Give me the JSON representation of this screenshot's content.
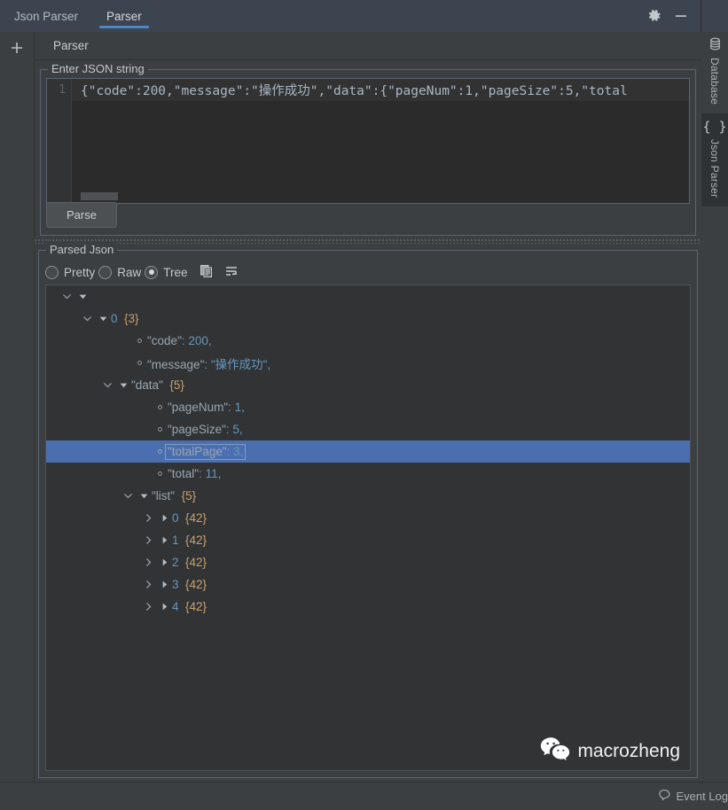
{
  "window": {
    "title": "Json Parser",
    "tabs": [
      {
        "label": "Json Parser",
        "active": false
      },
      {
        "label": "Parser",
        "active": true
      }
    ],
    "accent_color": "#4a88c7",
    "icons": {
      "settings": "gear-icon",
      "minimize": "minimize-icon"
    }
  },
  "left_toolbar": {
    "add_label": "+"
  },
  "right_stripe": {
    "buttons": [
      {
        "label": "Database",
        "icon": "database-icon",
        "selected": false
      },
      {
        "label": "Json Parser",
        "icon": "braces-icon",
        "selected": true
      }
    ]
  },
  "panel": {
    "title": "Parser"
  },
  "input_group": {
    "title": "Enter JSON string",
    "line_number": "1",
    "value": "{\"code\":200,\"message\":\"操作成功\",\"data\":{\"pageNum\":1,\"pageSize\":5,\"total",
    "parse_button": "Parse"
  },
  "output_group": {
    "title": "Parsed Json",
    "view_modes": [
      {
        "label": "Pretty",
        "selected": false
      },
      {
        "label": "Raw",
        "selected": false
      },
      {
        "label": "Tree",
        "selected": true
      }
    ],
    "tools": [
      {
        "name": "copy-icon",
        "label": "Copy"
      },
      {
        "name": "wrap-text-icon",
        "label": "Soft Wrap"
      }
    ],
    "tree": [
      {
        "indent": 0,
        "chevron": "down",
        "triangle": "down",
        "bullet": false,
        "key": "",
        "value": "",
        "count": "",
        "selected": false
      },
      {
        "indent": 1,
        "chevron": "down",
        "triangle": "down",
        "bullet": false,
        "key": "0",
        "value": "",
        "count": "{3}",
        "selected": false
      },
      {
        "indent": 2,
        "chevron": "",
        "triangle": "",
        "bullet": true,
        "key": "\"code\"",
        "value": "200,",
        "count": "",
        "selected": false
      },
      {
        "indent": 2,
        "chevron": "",
        "triangle": "",
        "bullet": true,
        "key": "\"message\"",
        "value": "\"操作成功\",",
        "count": "",
        "selected": false
      },
      {
        "indent": 2,
        "chevron": "down",
        "triangle": "down",
        "bullet": false,
        "key": "\"data\"",
        "value": "",
        "count": "{5}",
        "selected": false
      },
      {
        "indent": 3,
        "chevron": "",
        "triangle": "",
        "bullet": true,
        "key": "\"pageNum\"",
        "value": "1,",
        "count": "",
        "selected": false
      },
      {
        "indent": 3,
        "chevron": "",
        "triangle": "",
        "bullet": true,
        "key": "\"pageSize\"",
        "value": "5,",
        "count": "",
        "selected": false
      },
      {
        "indent": 3,
        "chevron": "",
        "triangle": "",
        "bullet": true,
        "key": "\"totalPage\"",
        "value": "3,",
        "count": "",
        "selected": true
      },
      {
        "indent": 3,
        "chevron": "",
        "triangle": "",
        "bullet": true,
        "key": "\"total\"",
        "value": "11,",
        "count": "",
        "selected": false
      },
      {
        "indent": 3,
        "chevron": "down",
        "triangle": "down",
        "bullet": false,
        "key": "\"list\"",
        "value": "",
        "count": "{5}",
        "selected": false
      },
      {
        "indent": 4,
        "chevron": "right",
        "triangle": "right",
        "bullet": false,
        "key": "0",
        "value": "",
        "count": "{42}",
        "selected": false
      },
      {
        "indent": 4,
        "chevron": "right",
        "triangle": "right",
        "bullet": false,
        "key": "1",
        "value": "",
        "count": "{42}",
        "selected": false
      },
      {
        "indent": 4,
        "chevron": "right",
        "triangle": "right",
        "bullet": false,
        "key": "2",
        "value": "",
        "count": "{42}",
        "selected": false
      },
      {
        "indent": 4,
        "chevron": "right",
        "triangle": "right",
        "bullet": false,
        "key": "3",
        "value": "",
        "count": "{42}",
        "selected": false
      },
      {
        "indent": 4,
        "chevron": "right",
        "triangle": "right",
        "bullet": false,
        "key": "4",
        "value": "",
        "count": "{42}",
        "selected": false
      }
    ]
  },
  "watermark": {
    "text": "macrozheng",
    "icon": "wechat-icon"
  },
  "status_bar": {
    "event_log_label": "Event Log",
    "event_log_icon": "balloon-icon"
  }
}
